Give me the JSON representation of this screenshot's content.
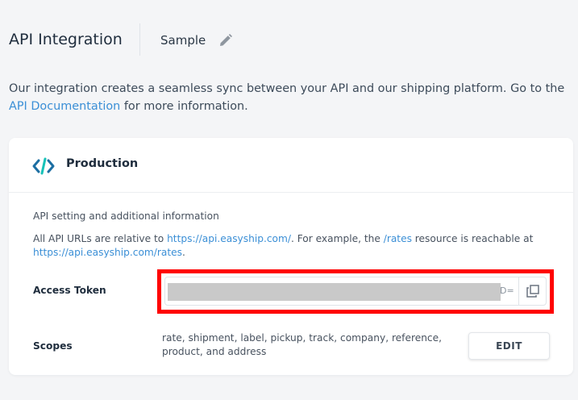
{
  "header": {
    "title": "API Integration",
    "app_name": "Sample",
    "edit_icon": "pencil-icon"
  },
  "intro": {
    "text_before": "Our integration creates a seamless sync between your API and our shipping platform. Go to the ",
    "link": "API Documentation",
    "text_after": " for more information."
  },
  "card": {
    "icon": "code-icon",
    "title": "Production",
    "section_label": "API setting and additional information",
    "url_note": {
      "part1": "All API URLs are relative to ",
      "base_url": "https://api.easyship.com/",
      "part2": ". For example, the ",
      "resource": "/rates",
      "part3": " resource is reachable at ",
      "example_url": "https://api.easyship.com/rates",
      "part4": "."
    },
    "access_token": {
      "label": "Access Token",
      "visible_suffix": "D=",
      "copy_icon": "copy-icon"
    },
    "scopes": {
      "label": "Scopes",
      "value": "rate, shipment, label, pickup, track, company, reference, product, and address",
      "edit_label": "EDIT"
    }
  },
  "colors": {
    "background": "#f4f5f7",
    "card": "#ffffff",
    "link": "#3b8fd6",
    "brand_icon": "#1d6fa3",
    "highlight": "#ff0000",
    "redaction": "#c9c9c9"
  }
}
